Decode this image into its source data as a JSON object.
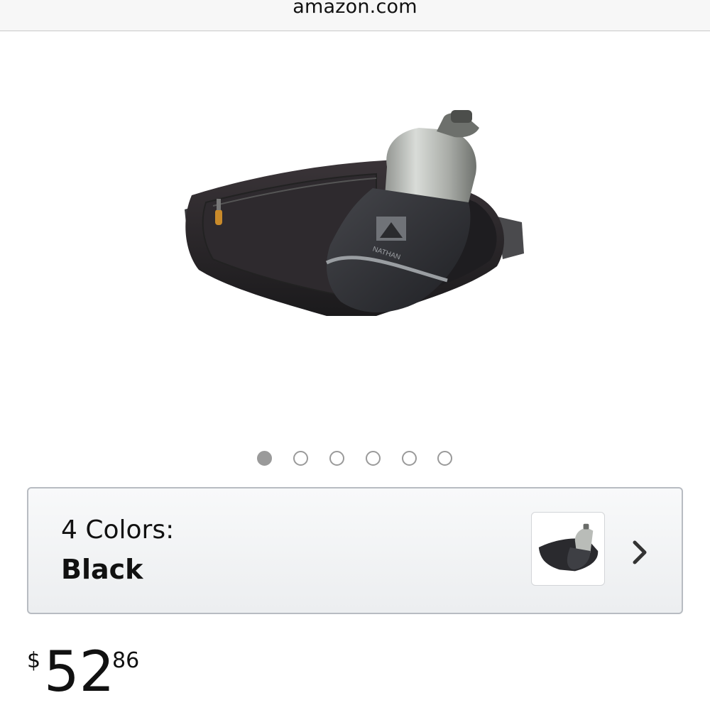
{
  "browser": {
    "url": "amazon.com"
  },
  "product": {
    "image_icon": "waist-pack-with-water-bottle",
    "brand_on_image": "NATHAN"
  },
  "carousel": {
    "total": 6,
    "active_index": 0
  },
  "color_selector": {
    "count_label": "4 Colors:",
    "selected_color": "Black",
    "chevron_icon": "chevron-right"
  },
  "price": {
    "currency": "$",
    "whole": "52",
    "fraction": "86"
  },
  "colors": {
    "url_bar_bg": "#f7f7f7",
    "dot_color": "#9a9a9a",
    "box_border": "#b8bcc2",
    "text": "#111111"
  }
}
